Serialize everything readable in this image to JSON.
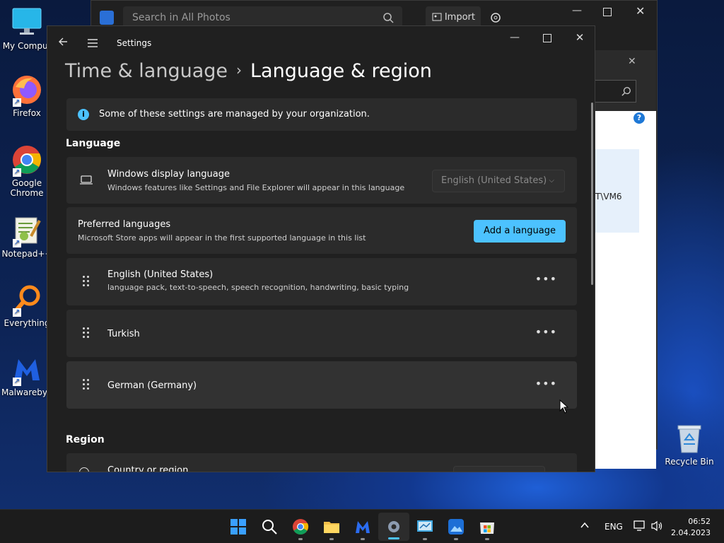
{
  "desktop": {
    "icons": [
      {
        "label": "My Comput"
      },
      {
        "label": "Firefox"
      },
      {
        "label": "Google Chrome"
      },
      {
        "label": "Notepad++"
      },
      {
        "label": "Everything"
      },
      {
        "label": "Malwarebyte"
      },
      {
        "label": "Recycle Bin"
      }
    ]
  },
  "photos": {
    "search_placeholder": "Search in All Photos",
    "import_label": "Import",
    "path_fragment": "T\\VM6"
  },
  "settings": {
    "app_title": "Settings",
    "breadcrumb": {
      "parent": "Time & language",
      "separator": "›",
      "current": "Language & region"
    },
    "notice": "Some of these settings are managed by your organization.",
    "language_header": "Language",
    "display_language": {
      "title": "Windows display language",
      "subtitle": "Windows features like Settings and File Explorer will appear in this language",
      "value": "English (United States)"
    },
    "preferred": {
      "title": "Preferred languages",
      "subtitle": "Microsoft Store apps will appear in the first supported language in this list",
      "button": "Add a language"
    },
    "languages": [
      {
        "name": "English (United States)",
        "details": "language pack, text-to-speech, speech recognition, handwriting, basic typing"
      },
      {
        "name": "Turkish",
        "details": ""
      },
      {
        "name": "German (Germany)",
        "details": ""
      }
    ],
    "region_header": "Region",
    "region_row": "Country or region"
  },
  "taskbar": {
    "lang": "ENG",
    "time": "06:52",
    "date": "2.04.2023"
  },
  "colors": {
    "accent": "#4cc2ff",
    "window_bg": "#202020",
    "card_bg": "#2b2b2b",
    "taskbar_bg": "#1c1c1c"
  }
}
